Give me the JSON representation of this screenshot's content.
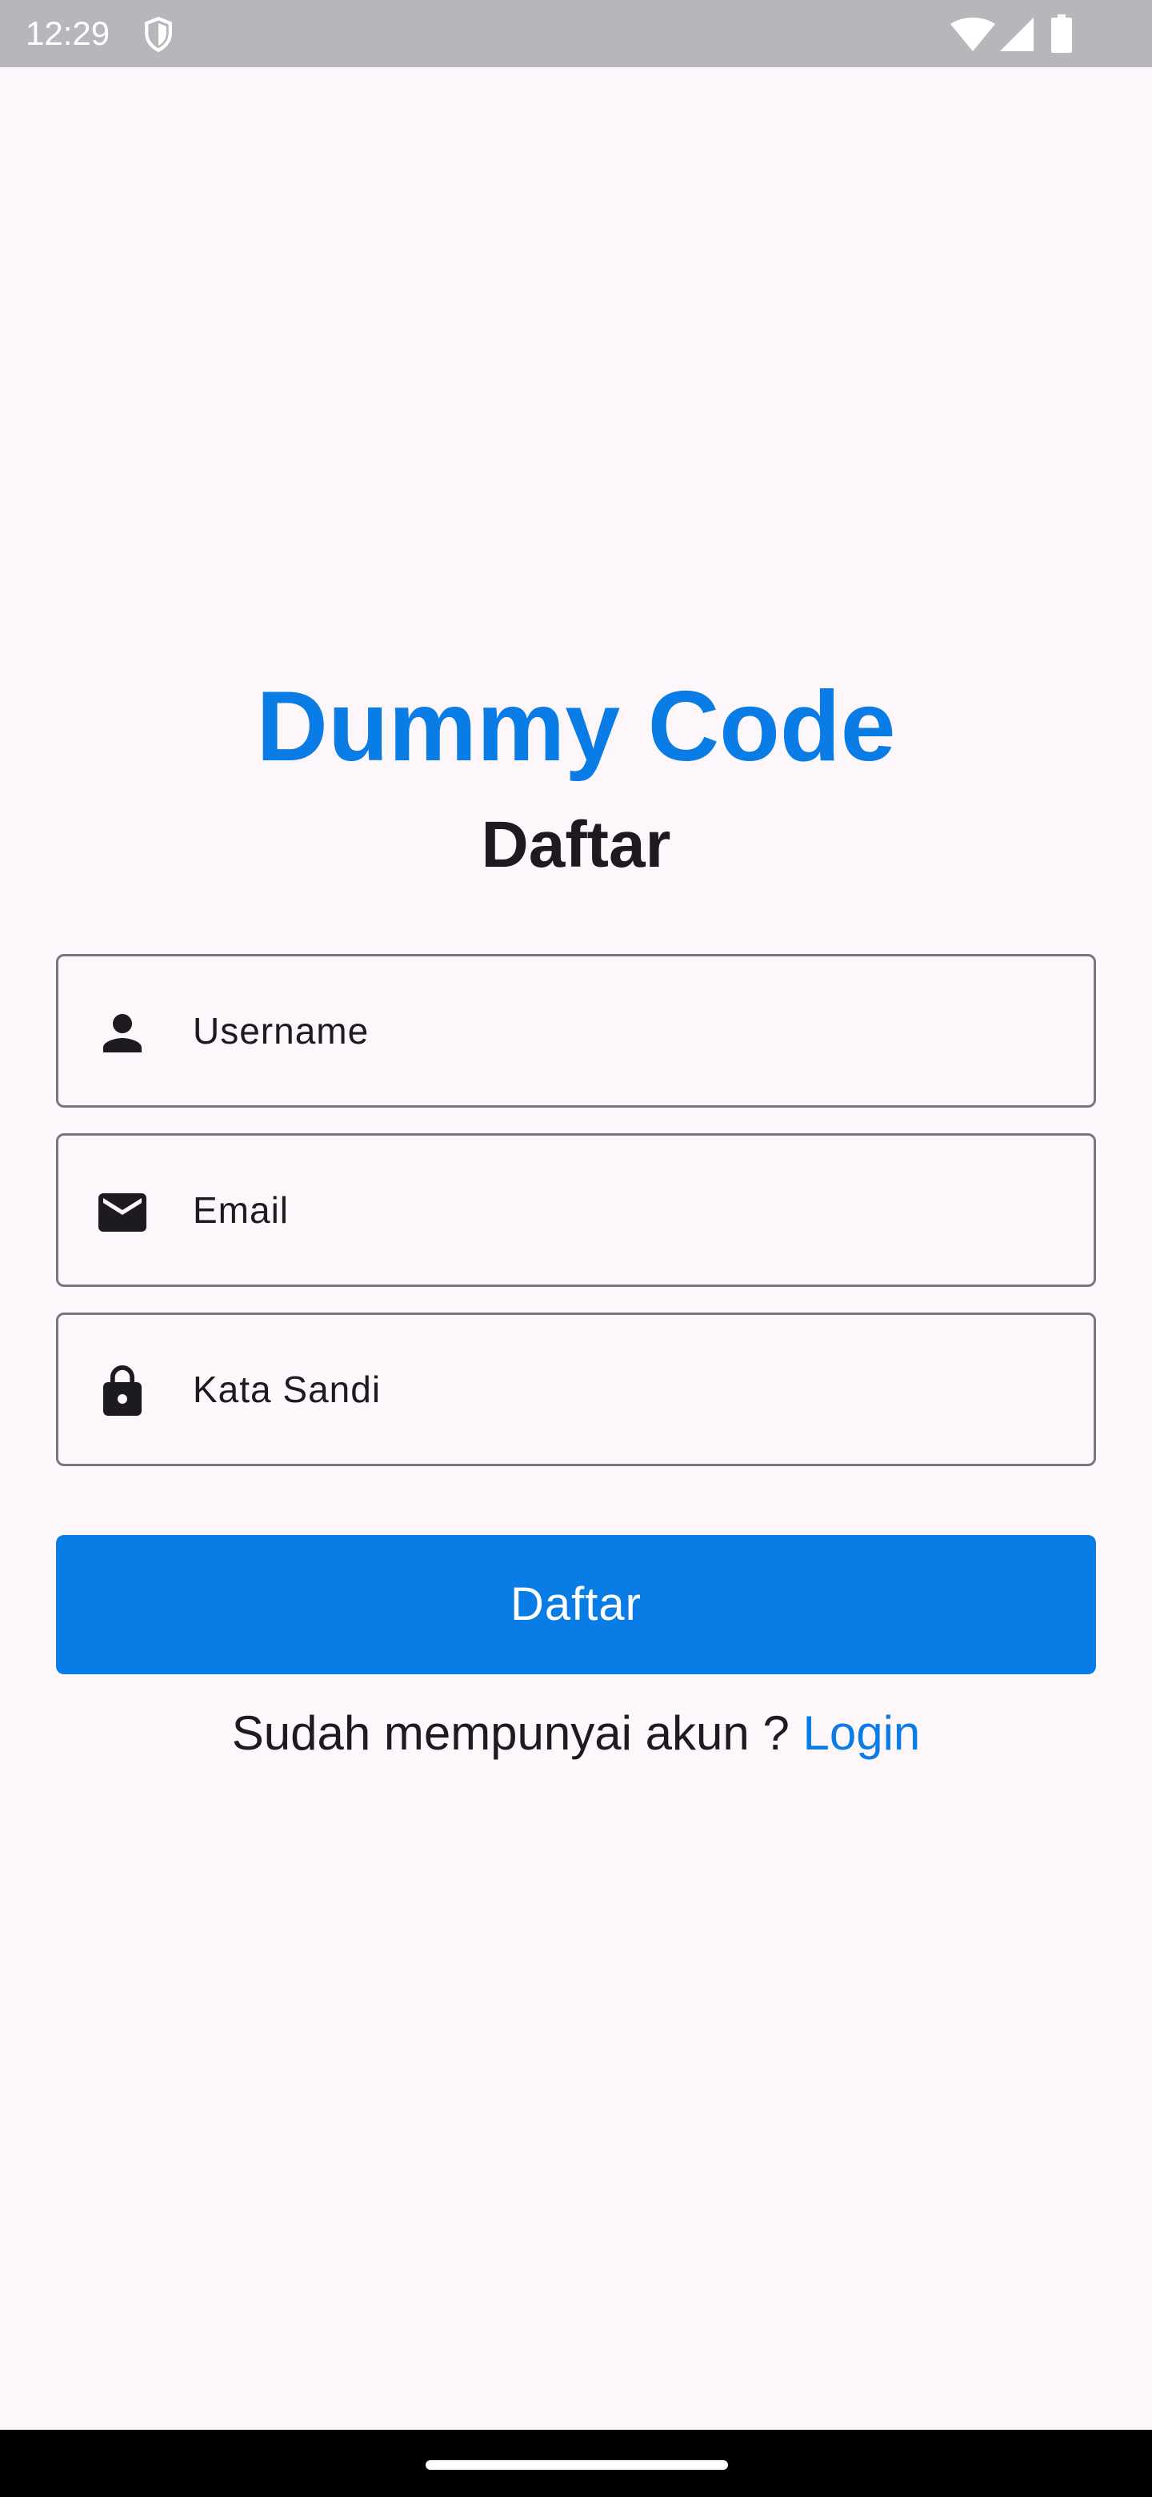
{
  "status_bar": {
    "time": "12:29",
    "icons": [
      "shield-icon",
      "wifi-icon",
      "signal-icon",
      "battery-icon"
    ]
  },
  "header": {
    "app_title": "Dummy Code",
    "page_title": "Daftar"
  },
  "form": {
    "fields": [
      {
        "icon": "person-icon",
        "placeholder": "Username",
        "value": ""
      },
      {
        "icon": "mail-icon",
        "placeholder": "Email",
        "value": ""
      },
      {
        "icon": "lock-icon",
        "placeholder": "Kata Sandi",
        "value": ""
      }
    ],
    "submit_label": "Daftar"
  },
  "footer": {
    "prompt_text": "Sudah mempunyai akun ?",
    "login_label": "Login"
  },
  "colors": {
    "accent": "#0a7ce6",
    "background": "#fdf7fc",
    "text": "#1d1b20",
    "status_bar": "#b9b6bb"
  }
}
